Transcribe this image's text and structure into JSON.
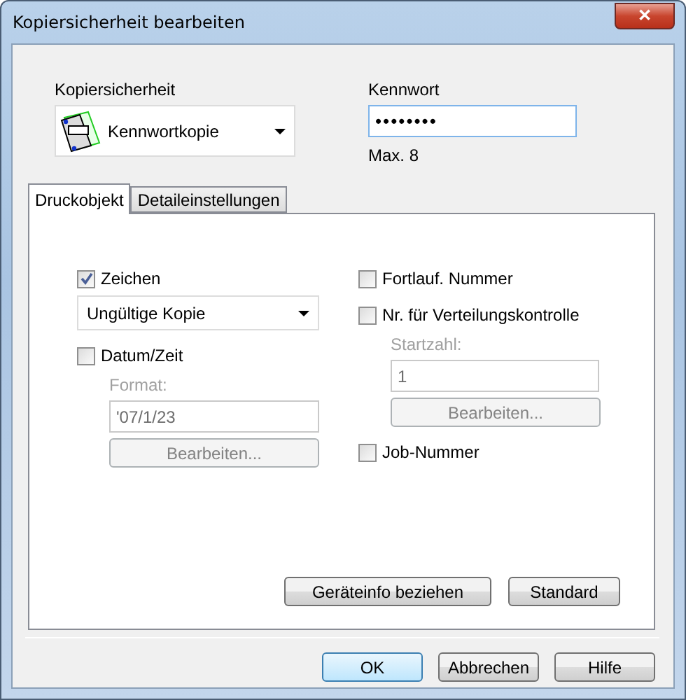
{
  "window": {
    "title": "Kopiersicherheit bearbeiten",
    "close": "✕"
  },
  "copy_protection": {
    "label": "Kopiersicherheit",
    "value": "Kennwortkopie"
  },
  "password": {
    "label": "Kennwort",
    "value": "••••••••",
    "hint": "Max. 8"
  },
  "tabs": [
    {
      "label": "Druckobjekt",
      "selected": true
    },
    {
      "label": "Detaileinstellungen",
      "selected": false
    }
  ],
  "left": [
    {
      "kind": "select",
      "label": "Zeichen",
      "checked": true,
      "value": "Ungültige Kopie"
    },
    {
      "kind": "field",
      "label": "Datum/Zeit",
      "checked": false,
      "field_label": "Format:",
      "value": "'07/1/23",
      "button": "Bearbeiten...",
      "disabled": true
    }
  ],
  "right": [
    {
      "kind": "plain",
      "label": "Fortlauf. Nummer",
      "checked": false
    },
    {
      "kind": "field",
      "label": "Nr. für Verteilungskontrolle",
      "checked": false,
      "field_label": "Startzahl:",
      "value": "1",
      "button": "Bearbeiten...",
      "disabled": true
    },
    {
      "kind": "plain",
      "label": "Job-Nummer",
      "checked": false
    }
  ],
  "panel_buttons": [
    "Geräteinfo beziehen",
    "Standard"
  ],
  "buttons": [
    {
      "label": "OK",
      "default": true
    },
    {
      "label": "Abbrechen",
      "default": false
    },
    {
      "label": "Hilfe",
      "default": false
    }
  ]
}
